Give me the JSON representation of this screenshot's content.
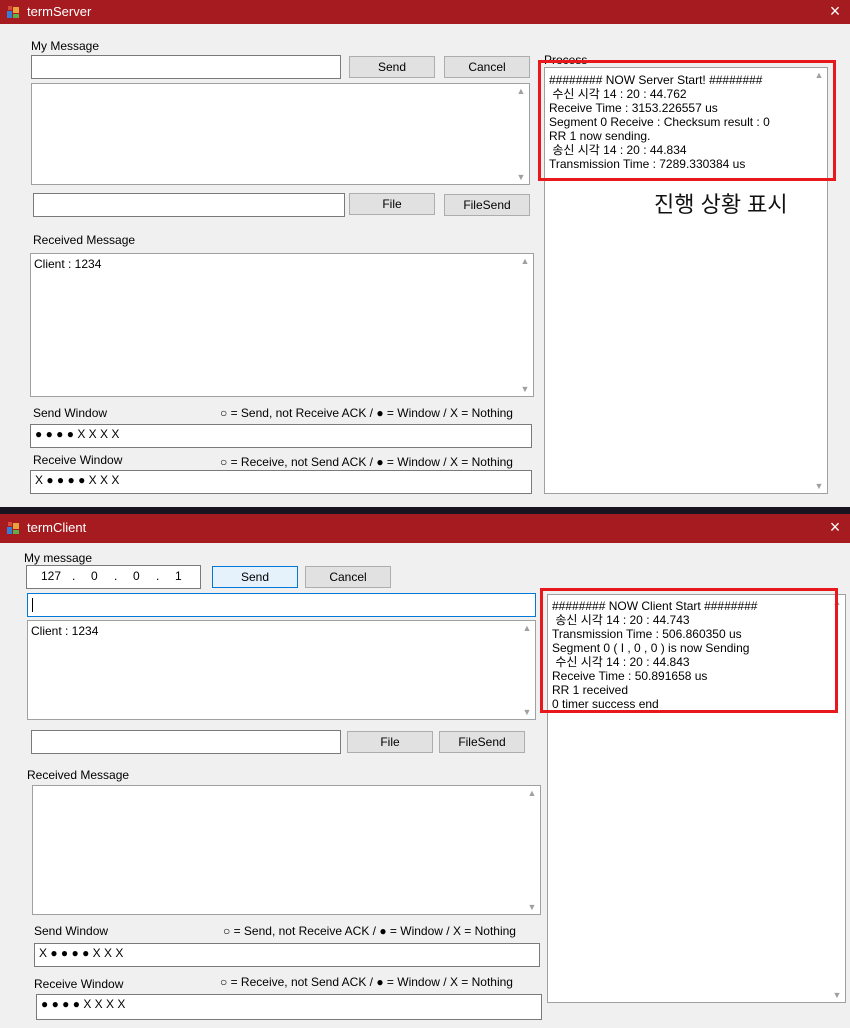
{
  "server": {
    "title": "termServer",
    "close_icon": "×",
    "my_message_label": "My Message",
    "send_label": "Send",
    "cancel_label": "Cancel",
    "file_label": "File",
    "filesend_label": "FileSend",
    "received_label": "Received Message",
    "received_lines": [
      "Client : 1234"
    ],
    "send_window_label": "Send Window",
    "send_legend": "○ = Send, not Receive ACK / ● = Window / X = Nothing",
    "send_window_value": "● ● ● ● X X X X",
    "receive_window_label": "Receive Window",
    "receive_legend": "○ = Receive, not Send ACK / ● = Window / X = Nothing",
    "receive_window_value": "X ● ● ● ● X X X",
    "process_label": "Process",
    "process_lines": [
      "######## NOW Server Start! ########",
      " 수신 시각 14 : 20 : 44.762",
      "Receive Time : 3153.226557 us",
      "Segment 0 Receive : Checksum result : 0",
      "RR 1 now sending.",
      " 송신 시각 14 : 20 : 44.834",
      "Transmission Time : 7289.330384 us"
    ],
    "annotation": "진행 상황 표시"
  },
  "client": {
    "title": "termClient",
    "close_icon": "×",
    "my_message_label": "My message",
    "ip_octets": [
      "127",
      "0",
      "0",
      "1"
    ],
    "ip_dot": ".",
    "send_label": "Send",
    "cancel_label": "Cancel",
    "message_lines": [
      "Client : 1234"
    ],
    "file_label": "File",
    "filesend_label": "FileSend",
    "received_label": "Received Message",
    "send_window_label": "Send Window",
    "send_legend": "○ = Send, not Receive ACK / ● = Window / X = Nothing",
    "send_window_value": "X ● ● ● ● X X X",
    "receive_window_label": "Receive Window",
    "receive_legend": "○ = Receive, not Send ACK / ● = Window / X = Nothing",
    "receive_window_value": "● ● ● ● X X X X",
    "process_lines": [
      "######## NOW Client Start ########",
      " 송신 시각 14 : 20 : 44.743",
      "Transmission Time : 506.860350 us",
      "Segment 0 ( I , 0 , 0 ) is now Sending",
      " 수신 시각 14 : 20 : 44.843",
      "Receive Time : 50.891658 us",
      "RR 1 received",
      "0 timer success end"
    ]
  },
  "colors": {
    "titlebar": "#a51b1f",
    "highlight": "#e8191c",
    "focus": "#0078d7"
  }
}
